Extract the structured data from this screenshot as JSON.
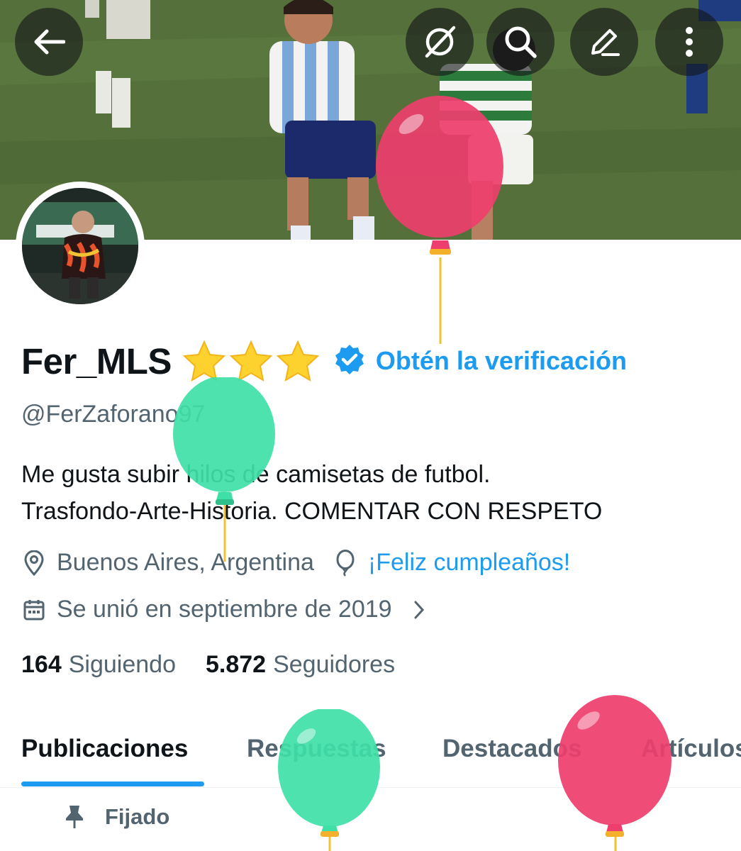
{
  "header": {
    "back_icon": "arrow-left-icon",
    "actions": [
      "grok-icon",
      "search-icon",
      "edit-icon",
      "more-vertical-icon"
    ]
  },
  "profile": {
    "display_name": "Fer_MLS",
    "stars": [
      "⭐",
      "⭐",
      "⭐"
    ],
    "get_verified": "Obtén la verificación",
    "handle": "@FerZaforano97",
    "bio_line1": "Me gusta subir hilos de camisetas de futbol.",
    "bio_line2": "Trasfondo-Arte-Historia. COMENTAR CON RESPETO",
    "location": "Buenos Aires, Argentina",
    "birthday": "¡Feliz cumpleaños!",
    "joined": "Se unió en septiembre de 2019",
    "following_count": "164",
    "following_label": "Siguiendo",
    "followers_count": "5.872",
    "followers_label": "Seguidores"
  },
  "tabs": [
    "Publicaciones",
    "Respuestas",
    "Destacados",
    "Artículos"
  ],
  "active_tab": "Publicaciones",
  "pinned_label": "Fijado",
  "colors": {
    "accent": "#1d9bf0",
    "text_primary": "#0f1419",
    "text_secondary": "#536471",
    "balloon_pink": "#ee3e6d",
    "balloon_green": "#3fe0a8"
  }
}
